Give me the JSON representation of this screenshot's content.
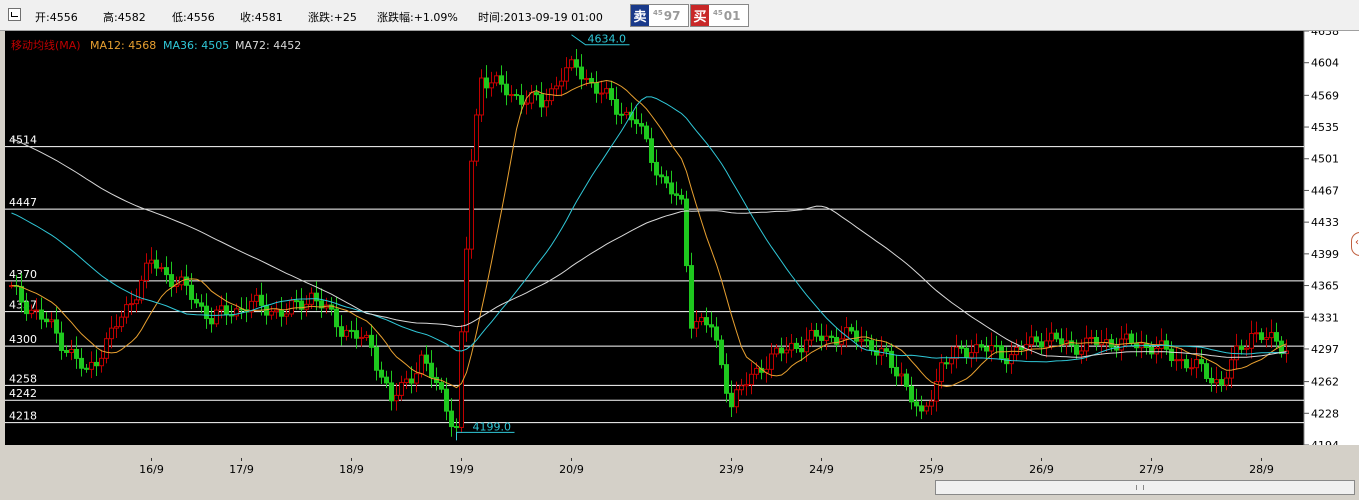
{
  "infobar": {
    "open_label": "开:",
    "open": "4556",
    "high_label": "高:",
    "high": "4582",
    "low_label": "低:",
    "low": "4556",
    "close_label": "收:",
    "close": "4581",
    "change_label": "涨跌:",
    "change": "+25",
    "change_pct_label": "涨跌幅:",
    "change_pct": "+1.09%",
    "time_label": "时间:",
    "time": "2013-09-19 01:00",
    "sell_tag": "卖",
    "sell_small": "45",
    "sell_price": "97",
    "buy_tag": "买",
    "buy_small": "45",
    "buy_price": "01"
  },
  "legend": {
    "title": "移动均线(MA)",
    "ma12": "MA12: 4568",
    "ma36": "MA36: 4505",
    "ma72": "MA72: 4452"
  },
  "colors": {
    "background": "#000000",
    "up": "#c00000",
    "down": "#1ec81e",
    "ma12": "#e8a030",
    "ma36": "#30c8d8",
    "ma72": "#d8d8d8",
    "hline": "#ffffff",
    "annotation": "#30c8d8"
  },
  "icons": {
    "side_button": "chevron-left-icon",
    "scroll_grip": "grip-icon"
  },
  "chart_data": {
    "type": "candlestick",
    "ylim": [
      4194,
      4638
    ],
    "y_ticks": [
      "4638",
      "4604",
      "4569",
      "4535",
      "4501",
      "4467",
      "4433",
      "4399",
      "4365",
      "4331",
      "4297",
      "4262",
      "4228",
      "4194"
    ],
    "horizontal_lines": [
      {
        "label": "4514",
        "value": 4514
      },
      {
        "label": "4447",
        "value": 4447
      },
      {
        "label": "4370",
        "value": 4370
      },
      {
        "label": "4337",
        "value": 4337
      },
      {
        "label": "4300",
        "value": 4300
      },
      {
        "label": "4258",
        "value": 4258
      },
      {
        "label": "4242",
        "value": 4242
      },
      {
        "label": "4218",
        "value": 4218
      }
    ],
    "x_ticks": [
      {
        "label": "16/9",
        "index": 28
      },
      {
        "label": "17/9",
        "index": 46
      },
      {
        "label": "18/9",
        "index": 68
      },
      {
        "label": "19/9",
        "index": 90
      },
      {
        "label": "20/9",
        "index": 112
      },
      {
        "label": "23/9",
        "index": 144
      },
      {
        "label": "24/9",
        "index": 162
      },
      {
        "label": "25/9",
        "index": 184
      },
      {
        "label": "26/9",
        "index": 206
      },
      {
        "label": "27/9",
        "index": 228
      },
      {
        "label": "28/9",
        "index": 250
      }
    ],
    "total_bars": 256,
    "annotations": [
      {
        "label": "4634.0",
        "index": 112,
        "value": 4634
      },
      {
        "label": "4199.0",
        "index": 89,
        "value": 4199
      }
    ],
    "key_closes": [
      [
        0,
        4360
      ],
      [
        8,
        4320
      ],
      [
        15,
        4270
      ],
      [
        22,
        4330
      ],
      [
        28,
        4390
      ],
      [
        34,
        4365
      ],
      [
        40,
        4330
      ],
      [
        48,
        4345
      ],
      [
        55,
        4335
      ],
      [
        60,
        4355
      ],
      [
        66,
        4320
      ],
      [
        72,
        4300
      ],
      [
        76,
        4240
      ],
      [
        82,
        4285
      ],
      [
        86,
        4250
      ],
      [
        89,
        4210
      ],
      [
        92,
        4500
      ],
      [
        94,
        4590
      ],
      [
        100,
        4570
      ],
      [
        106,
        4560
      ],
      [
        110,
        4590
      ],
      [
        113,
        4600
      ],
      [
        118,
        4570
      ],
      [
        125,
        4540
      ],
      [
        130,
        4480
      ],
      [
        134,
        4450
      ],
      [
        136,
        4330
      ],
      [
        140,
        4320
      ],
      [
        144,
        4240
      ],
      [
        150,
        4280
      ],
      [
        156,
        4300
      ],
      [
        162,
        4310
      ],
      [
        170,
        4310
      ],
      [
        178,
        4270
      ],
      [
        182,
        4220
      ],
      [
        186,
        4280
      ],
      [
        192,
        4300
      ],
      [
        200,
        4290
      ],
      [
        206,
        4310
      ],
      [
        212,
        4300
      ],
      [
        220,
        4305
      ],
      [
        228,
        4300
      ],
      [
        236,
        4280
      ],
      [
        242,
        4260
      ],
      [
        245,
        4290
      ],
      [
        248,
        4315
      ],
      [
        252,
        4305
      ],
      [
        255,
        4300
      ]
    ]
  }
}
